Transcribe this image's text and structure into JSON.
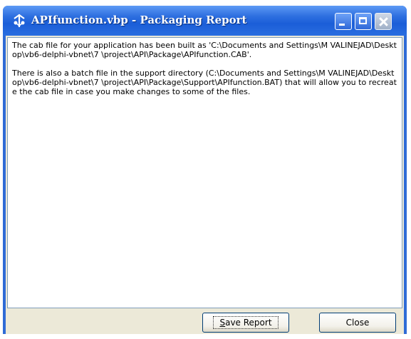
{
  "window": {
    "title": "APIfunction.vbp - Packaging Report",
    "app_icon": "vb-package-icon",
    "controls": {
      "minimize_icon": "minimize-icon",
      "maximize_icon": "maximize-icon",
      "close_icon": "close-icon"
    }
  },
  "report": {
    "paragraph_1": "The cab file for your application has been built as 'C:\\Documents and Settings\\M VALINEJAD\\Desktop\\vb6-delphi-vbnet\\7 \\project\\API\\Package\\APIfunction.CAB'.",
    "paragraph_2": "There is also a batch file in the support directory (C:\\Documents and Settings\\M VALINEJAD\\Desktop\\vb6-delphi-vbnet\\7 \\project\\API\\Package\\Support\\APIfunction.BAT) that will allow you to recreate the cab file in case you make changes to some of the files."
  },
  "buttons": {
    "save_report_mnemonic": "S",
    "save_report_rest": "ave Report",
    "close": "Close"
  }
}
